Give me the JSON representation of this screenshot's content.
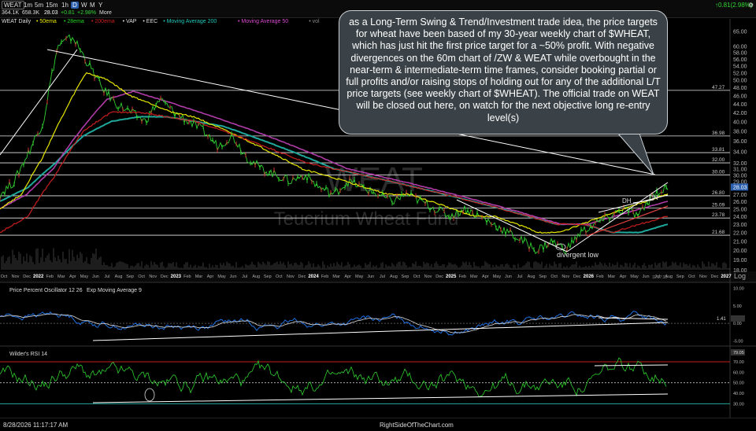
{
  "toolbar": {
    "symbol": "WEAT",
    "volume": "364.1K",
    "prev_volume": "658.3K",
    "last_price": "28.03",
    "change": "+0.81",
    "change_pct": "+2.98%",
    "more_label": "More",
    "intervals": [
      "1m",
      "5m",
      "15m",
      "1h",
      "D",
      "W",
      "M",
      "Y"
    ],
    "active_interval": "D",
    "right_change": "↑0.81(2.98%)"
  },
  "indicators_row": {
    "chart_name": "WEAT Daily",
    "items": [
      {
        "label": "50ema",
        "color": "#e6e600"
      },
      {
        "label": "28ema",
        "color": "#21d321"
      },
      {
        "label": "200ema",
        "color": "#c81e1e"
      },
      {
        "label": "VAP",
        "color": "#dddddd"
      },
      {
        "label": "EEC",
        "color": "#dddddd"
      },
      {
        "label": "Moving Average 200",
        "color": "#1fc7b8"
      },
      {
        "label": "Moving Average 50",
        "color": "#d94ad0"
      },
      {
        "label": "vol",
        "color": "#888888"
      }
    ]
  },
  "callout": {
    "text": "as a Long-Term Swing & Trend/Investment trade idea, the price targets for wheat have been based of my 30-year weekly chart of $WHEAT, which has just hit the first price target for a ~50% profit. With negative divergences on the 60m chart of /ZW & WEAT while overbought in the near-term & intermediate-term time frames, consider booking partial or full profits and/or raising stops of holding out for any of the additional L/T price targets (see weekly chart of $WHEAT). The official trade on WEAT will be closed out here, on watch for the next objective long re-entry level(s)"
  },
  "watermark": {
    "symbol": "WEAT",
    "name": "Teucrium Wheat Fund"
  },
  "annotations": {
    "divergent_low": "divergent low",
    "dh1": "DH",
    "dh2": "DH",
    "log_label": "Log",
    "time_stamp": "11:17:33"
  },
  "price_levels": [
    "65.00",
    "60.00",
    "58.00",
    "56.00",
    "54.00",
    "52.00",
    "50.00",
    "48.00",
    "46.00",
    "44.00",
    "42.00",
    "40.00",
    "38.00",
    "36.00",
    "34.00",
    "32.00",
    "31.00",
    "30.00",
    "29.00",
    "28.00",
    "27.00",
    "26.00",
    "25.00",
    "24.00",
    "23.00",
    "22.00",
    "21.00",
    "20.00",
    "19.00",
    "18.00"
  ],
  "key_levels": [
    "47.27",
    "36.98",
    "33.81",
    "32.00",
    "30.00",
    "26.80",
    "25.09",
    "23.78",
    "21.68"
  ],
  "last_price_tag": "28.03",
  "x_axis": [
    "Oct",
    "Nov",
    "Dec",
    "2022",
    "Feb",
    "Mar",
    "Apr",
    "May",
    "Jun",
    "Jul",
    "Aug",
    "Sep",
    "Oct",
    "Nov",
    "Dec",
    "2023",
    "Feb",
    "Mar",
    "Apr",
    "May",
    "Jun",
    "Jul",
    "Aug",
    "Sep",
    "Oct",
    "Nov",
    "Dec",
    "2024",
    "Feb",
    "Mar",
    "Apr",
    "May",
    "Jun",
    "Jul",
    "Aug",
    "Sep",
    "Oct",
    "Nov",
    "Dec",
    "2025",
    "Feb",
    "Mar",
    "Apr",
    "May",
    "Jun",
    "Jul",
    "Aug",
    "Sep",
    "Oct",
    "Nov",
    "Dec",
    "2026",
    "Feb",
    "Mar",
    "Apr",
    "May",
    "Jun",
    "Jul",
    "Aug",
    "Sep",
    "Oct",
    "Nov",
    "Dec",
    "2027"
  ],
  "ppo_panel": {
    "legend": "Price Percent Oscillator 12 26",
    "legend2": "Exp Moving Average 9",
    "tag": "1.41",
    "levels": [
      "10.00",
      "5.00",
      "0.00",
      "-5.00"
    ]
  },
  "rsi_panel": {
    "legend": "Wilder's RSI 14",
    "levels": [
      "70.00",
      "60.00",
      "50.00",
      "40.00",
      "30.00"
    ],
    "tag": "79.05"
  },
  "footer": {
    "timestamp": "8/28/2026 11:17:17 AM",
    "site": "RightSideOfTheChart.com"
  },
  "chart_data": {
    "type": "line",
    "title": "WEAT Daily",
    "scale": "log",
    "ylim": [
      18,
      66
    ],
    "series": [
      {
        "name": "price",
        "values": [
          27,
          29,
          34,
          40,
          60,
          63,
          55,
          48,
          44,
          42,
          40,
          45,
          42,
          40,
          38,
          35,
          37,
          33,
          31,
          30,
          29,
          30,
          28,
          27,
          29,
          28,
          27,
          26,
          27,
          26,
          25,
          24,
          25,
          24,
          23,
          22,
          21,
          20,
          21,
          20,
          22,
          23,
          24,
          25,
          24,
          27,
          28
        ]
      },
      {
        "name": "50ema",
        "values": [
          25,
          27,
          33,
          42,
          52,
          50,
          46,
          44,
          42,
          41,
          39,
          37,
          35,
          33,
          31,
          30,
          29,
          28,
          27,
          27,
          26,
          25,
          24,
          24,
          23,
          22,
          22,
          23,
          24,
          25,
          26,
          27
        ]
      },
      {
        "name": "200ema",
        "values": [
          22,
          24,
          30,
          38,
          42,
          42,
          41,
          40,
          38,
          36,
          34,
          32,
          31,
          30,
          29,
          28,
          27,
          26,
          25,
          24,
          23,
          23,
          22,
          23,
          24
        ]
      }
    ],
    "ppo": {
      "last": 1.41,
      "ylim": [
        -6,
        11
      ]
    },
    "rsi": {
      "last": 79.05,
      "ylim": [
        25,
        82
      ],
      "overbought": 70,
      "oversold": 30
    }
  }
}
